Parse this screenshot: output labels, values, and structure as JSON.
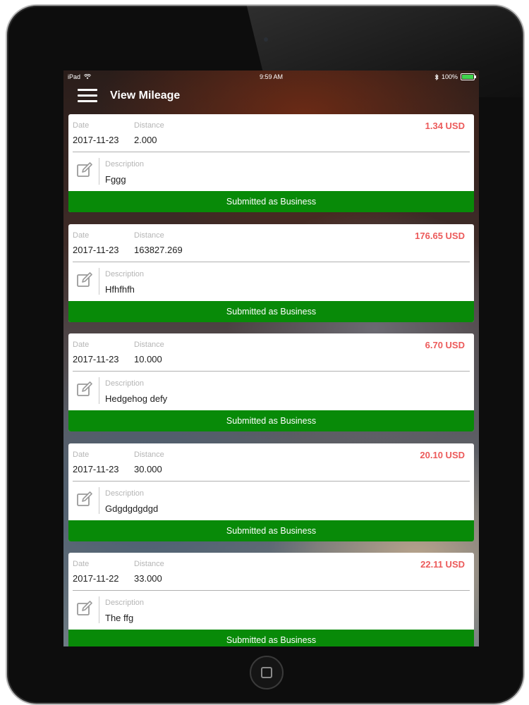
{
  "status_bar": {
    "device": "iPad",
    "time": "9:59 AM",
    "battery": "100%"
  },
  "nav": {
    "title": "View Mileage"
  },
  "labels": {
    "date": "Date",
    "distance": "Distance",
    "description": "Description"
  },
  "entries": [
    {
      "date": "2017-11-23",
      "distance": "2.000",
      "amount": "1.34 USD",
      "description": "Fggg",
      "status": "Submitted as Business"
    },
    {
      "date": "2017-11-23",
      "distance": "163827.269",
      "amount": "176.65 USD",
      "description": "Hfhfhfh",
      "status": "Submitted as Business"
    },
    {
      "date": "2017-11-23",
      "distance": "10.000",
      "amount": "6.70 USD",
      "description": "Hedgehog defy",
      "status": "Submitted as Business"
    },
    {
      "date": "2017-11-23",
      "distance": "30.000",
      "amount": "20.10 USD",
      "description": "Gdgdgdgdgd",
      "status": "Submitted as Business"
    },
    {
      "date": "2017-11-22",
      "distance": "33.000",
      "amount": "22.11 USD",
      "description": "The ffg",
      "status": "Submitted as Business"
    }
  ],
  "colors": {
    "amount": "#ec5a5a",
    "status_green": "#088a08",
    "nav_text": "#ffffff"
  },
  "icons": {
    "menu": "hamburger-menu-icon",
    "edit": "edit-note-icon",
    "bluetooth": "bluetooth-icon",
    "wifi": "wifi-icon",
    "battery": "battery-icon"
  }
}
